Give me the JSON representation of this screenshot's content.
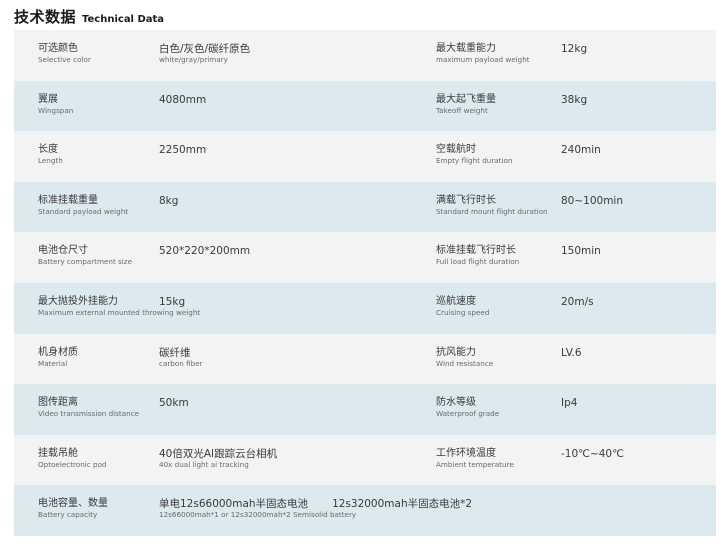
{
  "header": {
    "title_cn": "技术数据",
    "title_en": "Technical Data"
  },
  "rows": [
    {
      "left": {
        "cn": "可选颜色",
        "en": "Selective color",
        "value": "白色/灰色/碳纤原色",
        "value_sub": "white/gray/primary"
      },
      "right": {
        "cn": "最大载重能力",
        "en": "maximum payload weight",
        "value": "12kg"
      }
    },
    {
      "left": {
        "cn": "翼展",
        "en": "Wingspan",
        "value": "4080mm"
      },
      "right": {
        "cn": "最大起飞重量",
        "en": "Takeoff weight",
        "value": "38kg"
      }
    },
    {
      "left": {
        "cn": "长度",
        "en": "Length",
        "value": "2250mm"
      },
      "right": {
        "cn": "空载航时",
        "en": "Empty flight duration",
        "value": "240min"
      }
    },
    {
      "left": {
        "cn": "标准挂载重量",
        "en": "Standard payload weight",
        "value": "8kg"
      },
      "right": {
        "cn": "满载飞行时长",
        "en": "Standard mount flight duration",
        "value": "80~100min"
      }
    },
    {
      "left": {
        "cn": "电池仓尺寸",
        "en": "Battery compartment size",
        "value": "520*220*200mm"
      },
      "right": {
        "cn": "标准挂载飞行时长",
        "en": "Full load flight duration",
        "value": "150min"
      }
    },
    {
      "left": {
        "cn": "最大抛投外挂能力",
        "en": "Maximum external mounted throwing weight",
        "value": "15kg"
      },
      "right": {
        "cn": "巡航速度",
        "en": "Cruising speed",
        "value": "20m/s"
      }
    },
    {
      "left": {
        "cn": "机身材质",
        "en": "Material",
        "value": "碳纤维",
        "value_sub": "carbon fiber"
      },
      "right": {
        "cn": "抗风能力",
        "en": "Wind resistance",
        "value": "LV.6"
      }
    },
    {
      "left": {
        "cn": "图传距离",
        "en": "Video transmission distance",
        "value": "50km"
      },
      "right": {
        "cn": "防水等级",
        "en": "Waterproof grade",
        "value": "Ip4"
      }
    },
    {
      "left": {
        "cn": "挂载吊舱",
        "en": "Optoelectronic pod",
        "value": "40倍双光AI跟踪云台相机",
        "value_sub": "40x dual light ai tracking"
      },
      "right": {
        "cn": "工作环境温度",
        "en": "Ambient temperature",
        "value": "-10℃~40℃"
      }
    },
    {
      "left": {
        "cn": "电池容量、数量",
        "en": "Battery capacity",
        "value": "单电12s66000mah半固态电池",
        "value2": "12s32000mah半固态电池*2",
        "value_sub": "12s66000mah*1  or  12s32000mah*2 Semisolid battery"
      }
    }
  ]
}
